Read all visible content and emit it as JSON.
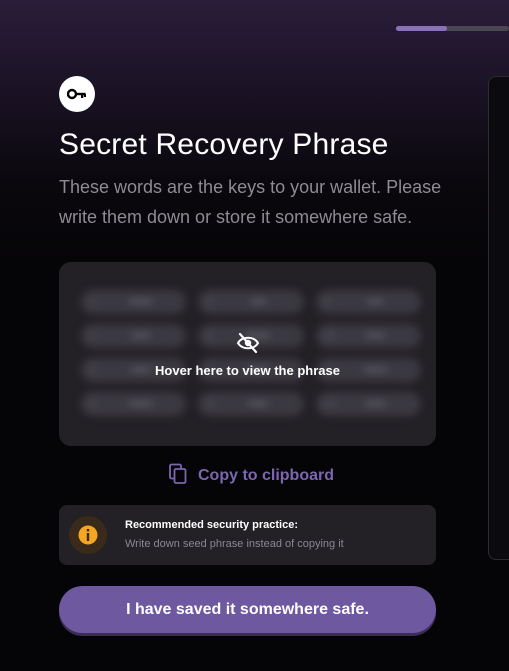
{
  "progress": {
    "fraction": 0.45,
    "fill_color": "#8b72b8"
  },
  "header": {
    "icon": "key-icon",
    "title": "Secret Recovery Phrase",
    "subtitle": "These words are the keys to your wallet. Please write them down or store it somewhere safe."
  },
  "phrase": {
    "reveal_icon": "eye-off-icon",
    "reveal_label": "Hover here to view the phrase",
    "words": [
      {
        "n": "1.",
        "w": "••••••"
      },
      {
        "n": "2.",
        "w": "•••••"
      },
      {
        "n": "3.",
        "w": "•••••"
      },
      {
        "n": "4.",
        "w": "••••••"
      },
      {
        "n": "5.",
        "w": "••••"
      },
      {
        "n": "6.",
        "w": "••••••"
      },
      {
        "n": "7.",
        "w": "•••••"
      },
      {
        "n": "8.",
        "w": "•••••"
      },
      {
        "n": "9.",
        "w": "••••"
      },
      {
        "n": "10.",
        "w": "•••••"
      },
      {
        "n": "11.",
        "w": "••••••"
      },
      {
        "n": "12.",
        "w": "•••••"
      }
    ]
  },
  "copy": {
    "icon": "copy-icon",
    "label": "Copy to clipboard"
  },
  "notice": {
    "icon": "info-icon",
    "title": "Recommended security practice:",
    "text": "Write down seed phrase instead of copying it"
  },
  "primary_button": {
    "label": "I have saved it somewhere safe."
  },
  "colors": {
    "accent": "#6e58a0",
    "link": "#7c66b0",
    "warning": "#f5a623"
  }
}
